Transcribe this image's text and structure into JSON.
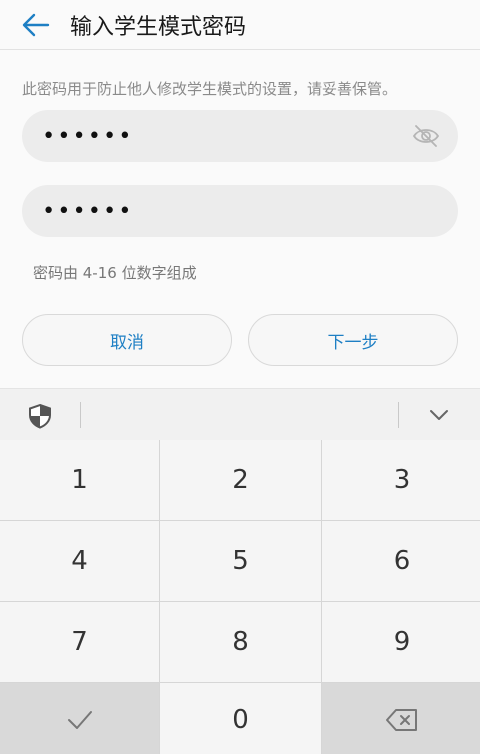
{
  "header": {
    "back_icon": "back-arrow-icon",
    "title": "输入学生模式密码"
  },
  "hint": "此密码用于防止他人修改学生模式的设置，请妥善保管。",
  "password_field": {
    "value": "••••••",
    "visibility_icon": "eye-off-icon"
  },
  "confirm_field": {
    "value": "••••••"
  },
  "rule_text": "密码由 4-16 位数字组成",
  "buttons": {
    "cancel": "取消",
    "next": "下一步"
  },
  "colors": {
    "accent": "#1e7fc4",
    "field_bg": "#ececec"
  },
  "keyboard": {
    "toolbar": {
      "security_icon": "shield-icon",
      "collapse_icon": "chevron-down-icon"
    },
    "keys": [
      "1",
      "2",
      "3",
      "4",
      "5",
      "6",
      "7",
      "8",
      "9"
    ],
    "zero": "0",
    "confirm_icon": "checkmark-icon",
    "delete_icon": "backspace-icon"
  }
}
